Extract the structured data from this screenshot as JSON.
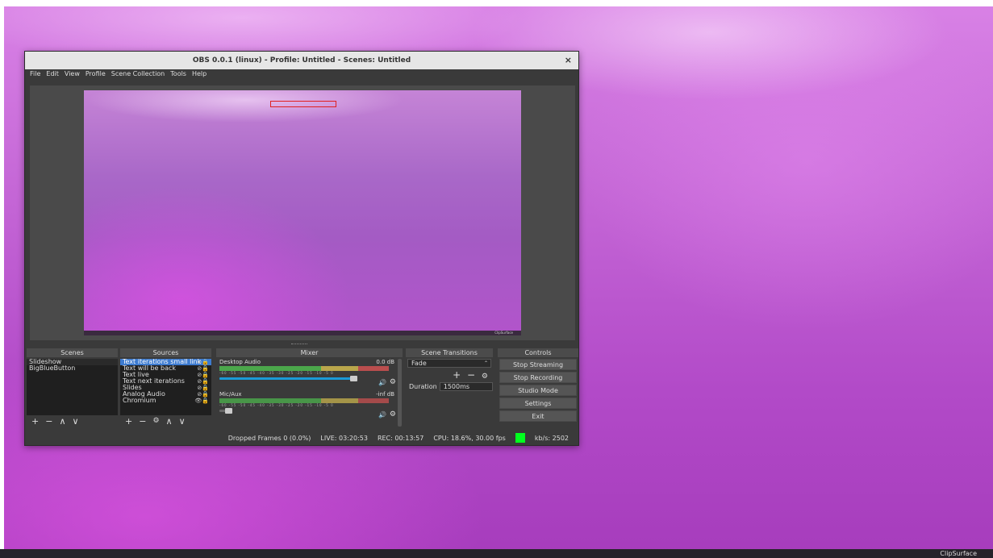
{
  "window": {
    "title": "OBS 0.0.1 (linux) - Profile: Untitled - Scenes: Untitled",
    "close": "×"
  },
  "menu": [
    "File",
    "Edit",
    "View",
    "Profile",
    "Scene Collection",
    "Tools",
    "Help"
  ],
  "docks": {
    "scenes": "Scenes",
    "sources": "Sources",
    "mixer": "Mixer",
    "transitions": "Scene Transitions",
    "controls": "Controls"
  },
  "scenes": [
    "Slideshow",
    "BigBlueButton"
  ],
  "sources": [
    {
      "name": "Text iterations small link",
      "icons": "⊘🔒"
    },
    {
      "name": "Text will be back",
      "icons": "⊘🔒"
    },
    {
      "name": "Text live",
      "icons": "⊘🔒"
    },
    {
      "name": "Text next iterations",
      "icons": "⊘🔒"
    },
    {
      "name": "Slides",
      "icons": "⊘🔒"
    },
    {
      "name": "Analog Audio",
      "icons": "⊘🔒"
    },
    {
      "name": "Chromium",
      "icons": "👁🔒"
    }
  ],
  "mixer": [
    {
      "name": "Desktop Audio",
      "db": "0.0 dB",
      "scale": "-60 -55 -50 -45 -40 -35 -30 -25 -20 -15 -10 -5 0"
    },
    {
      "name": "Mic/Aux",
      "db": "-inf dB",
      "scale": "-60 -55 -50 -45 -40 -35 -30 -25 -20 -15 -10 -5 0"
    }
  ],
  "transitions": {
    "selected": "Fade",
    "duration_label": "Duration",
    "duration": "1500ms"
  },
  "controls": [
    "Stop Streaming",
    "Stop Recording",
    "Studio Mode",
    "Settings",
    "Exit"
  ],
  "status": {
    "dropped": "Dropped Frames 0 (0.0%)",
    "live": "LIVE: 03:20:53",
    "rec": "REC: 00:13:57",
    "cpu": "CPU: 18.6%, 30.00 fps",
    "kbs": "kb/s: 2502",
    "indicator_color": "#00ff1e"
  },
  "canvas_logo": "ClipSurface",
  "taskbar": {
    "label": "ClipSurface"
  }
}
